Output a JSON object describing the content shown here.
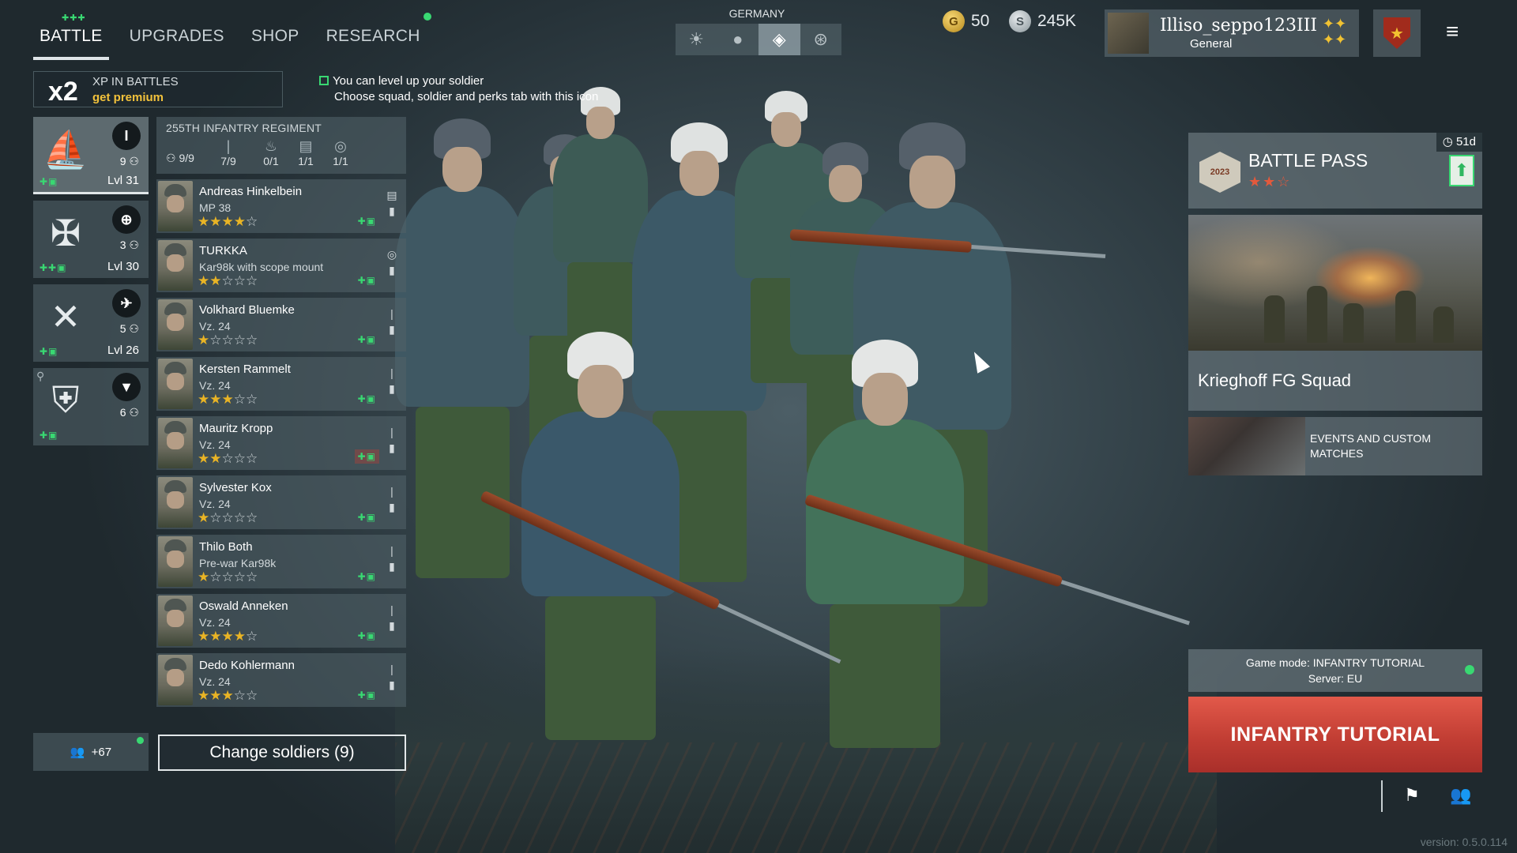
{
  "nav": {
    "tabs": [
      {
        "label": "BATTLE",
        "badges": "✚✚✚"
      },
      {
        "label": "UPGRADES"
      },
      {
        "label": "SHOP"
      },
      {
        "label": "RESEARCH"
      }
    ],
    "active_tab": "BATTLE"
  },
  "xp_banner": {
    "multiplier": "x2",
    "label": "XP IN BATTLES",
    "premium_link": "get premium"
  },
  "tip": {
    "line1": "You can level up your soldier",
    "line2": "Choose squad, soldier and perks tab with this icon"
  },
  "nation": {
    "label": "GERMANY",
    "tabs": [
      {
        "icon": "sun-emblem-icon",
        "glyph": "☀"
      },
      {
        "icon": "circle-emblem-icon",
        "glyph": "●"
      },
      {
        "icon": "diamond-emblem-icon",
        "glyph": "◈"
      },
      {
        "icon": "wheel-emblem-icon",
        "glyph": "⊛"
      }
    ],
    "active_index": 2
  },
  "currency": {
    "gold_symbol": "G",
    "gold": "50",
    "silver_symbol": "S",
    "silver": "245K"
  },
  "profile": {
    "name": "Illiso_seppo123III",
    "rank": "General",
    "rank_icon": "✦✦\n✦✦"
  },
  "squads": [
    {
      "type_icon": "I",
      "count": "9",
      "level": "Lvl 31",
      "emblem": "⛵",
      "ups": "✚▣"
    },
    {
      "type_icon": "⊕",
      "count": "3",
      "level": "Lvl 30",
      "emblem": "✠",
      "ups": "✚✚▣"
    },
    {
      "type_icon": "✈",
      "count": "5",
      "level": "Lvl 26",
      "emblem": "✕",
      "ups": "✚▣"
    },
    {
      "type_icon": "▼",
      "count": "6",
      "level": "",
      "emblem": "⛨",
      "ups": "✚▣"
    }
  ],
  "roster": {
    "regiment": "255TH INFANTRY REGIMENT",
    "capacity": "9/9",
    "slots": [
      {
        "icon": "rifle-slot-icon",
        "glyph": "|",
        "value": "7/9"
      },
      {
        "icon": "flame-slot-icon",
        "glyph": "♨",
        "value": "0/1"
      },
      {
        "icon": "radio-slot-icon",
        "glyph": "▤",
        "value": "1/1"
      },
      {
        "icon": "scope-slot-icon",
        "glyph": "◎",
        "value": "1/1"
      }
    ],
    "soldiers": [
      {
        "name": "Andreas Hinkelbein",
        "weapon": "MP 38",
        "stars": 4
      },
      {
        "name": "TURKKA",
        "weapon": "Kar98k with scope mount",
        "stars": 2
      },
      {
        "name": "Volkhard Bluemke",
        "weapon": "Vz. 24",
        "stars": 1
      },
      {
        "name": "Kersten Rammelt",
        "weapon": "Vz. 24",
        "stars": 3
      },
      {
        "name": "Mauritz Kropp",
        "weapon": "Vz. 24",
        "stars": 2
      },
      {
        "name": "Sylvester Kox",
        "weapon": "Vz. 24",
        "stars": 1
      },
      {
        "name": "Thilo Both",
        "weapon": "Pre-war Kar98k",
        "stars": 1
      },
      {
        "name": "Oswald Anneken",
        "weapon": "Vz. 24",
        "stars": 4
      },
      {
        "name": "Dedo Kohlermann",
        "weapon": "Vz. 24",
        "stars": 3
      }
    ],
    "ups_glyph": "✚▣",
    "reserve_count": "+67",
    "change_button": "Change soldiers (9)"
  },
  "battle_pass": {
    "title": "BATTLE PASS",
    "timer": "51d",
    "stars": "★★☆",
    "emblem_year": "2023",
    "upgrade_icon": "⬆"
  },
  "featured": {
    "name": "Krieghoff FG Squad"
  },
  "events": {
    "label": "EVENTS AND CUSTOM MATCHES"
  },
  "game_mode": {
    "line1": "Game mode: INFANTRY TUTORIAL",
    "line2": "Server: EU"
  },
  "play_button": {
    "label": "INFANTRY TUTORIAL"
  },
  "footer": {
    "version": "version: 0.5.0.114",
    "flag_icon": "⚑",
    "friends_icon": "👥"
  },
  "colors": {
    "accent_green": "#39d872",
    "play_red": "#c23e34",
    "star_gold": "#e9b425",
    "panel": "#50606b"
  }
}
